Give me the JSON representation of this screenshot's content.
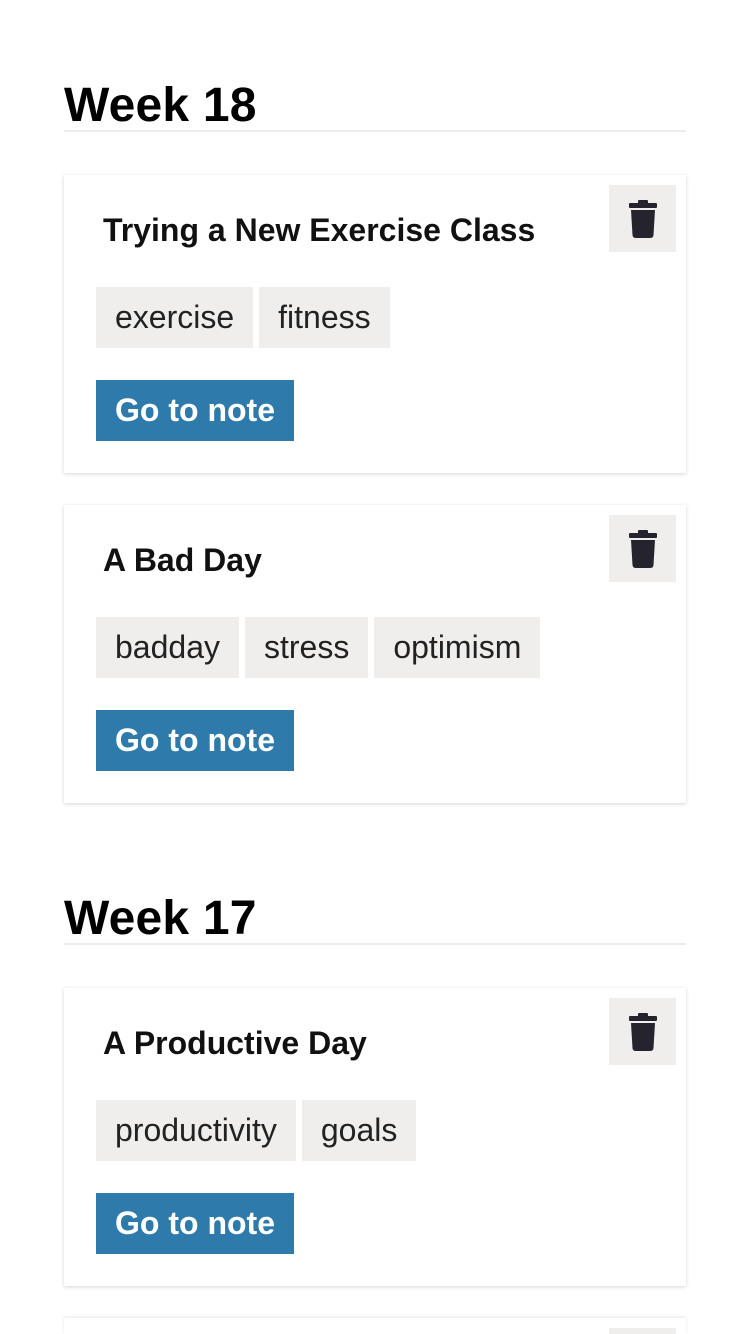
{
  "weeks": [
    {
      "heading": "Week 18",
      "notes": [
        {
          "title": "Trying a New Exercise Class",
          "tags": [
            "exercise",
            "fitness"
          ],
          "go_label": "Go to note"
        },
        {
          "title": "A Bad Day",
          "tags": [
            "badday",
            "stress",
            "optimism"
          ],
          "go_label": "Go to note"
        }
      ]
    },
    {
      "heading": "Week 17",
      "notes": [
        {
          "title": "A Productive Day",
          "tags": [
            "productivity",
            "goals"
          ],
          "go_label": "Go to note"
        }
      ]
    }
  ],
  "icons": {
    "delete": "trash-icon"
  },
  "colors": {
    "primary_button": "#2e7bab",
    "tag_background": "#efeeed",
    "icon": "#25232e"
  }
}
